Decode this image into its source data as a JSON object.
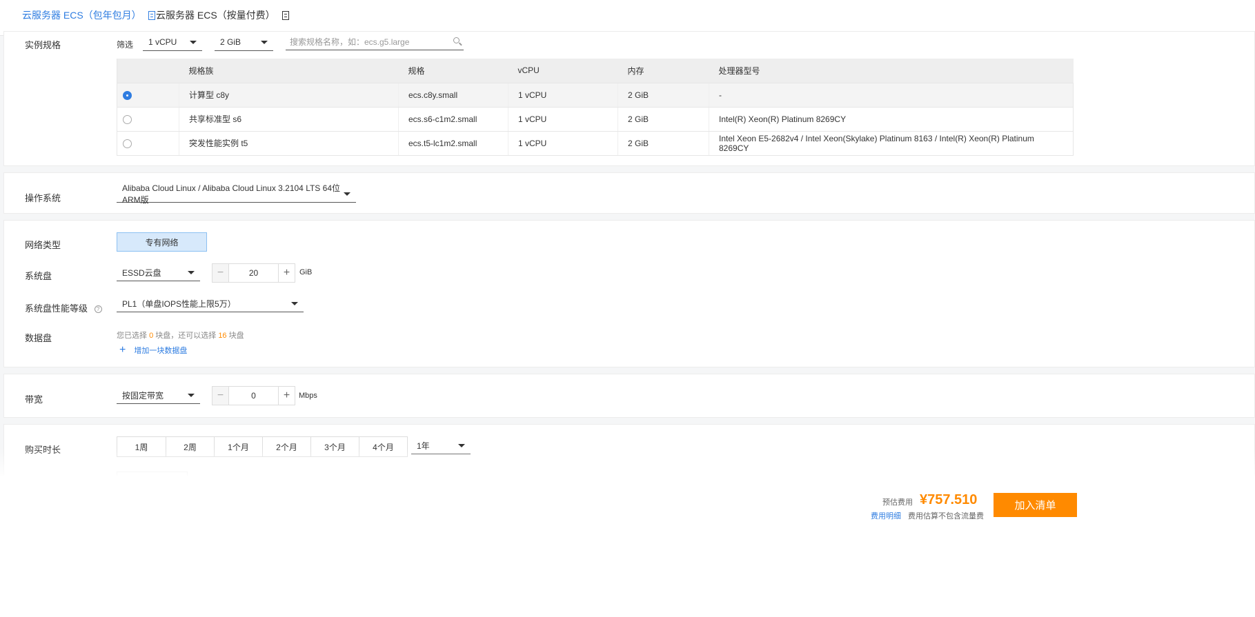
{
  "top_tabs": [
    {
      "label": "云服务器 ECS（包年包月）",
      "icon": "document-icon"
    },
    {
      "label": "云服务器 ECS（按量付费）",
      "icon": "document-icon"
    }
  ],
  "instance": {
    "label": "实例规格",
    "filter_label": "筛选",
    "cpu_select": "1 vCPU",
    "mem_select": "2 GiB",
    "search_placeholder": "搜索规格名称，如：ecs.g5.large",
    "columns": [
      "",
      "规格族",
      "规格",
      "vCPU",
      "内存",
      "处理器型号"
    ],
    "rows": [
      [
        "计算型 c8y",
        "ecs.c8y.small",
        "1 vCPU",
        "2 GiB",
        "-"
      ],
      [
        "共享标准型 s6",
        "ecs.s6-c1m2.small",
        "1 vCPU",
        "2 GiB",
        "Intel(R) Xeon(R) Platinum 8269CY"
      ],
      [
        "突发性能实例 t5",
        "ecs.t5-lc1m2.small",
        "1 vCPU",
        "2 GiB",
        "Intel Xeon E5-2682v4 / Intel Xeon(Skylake) Platinum 8163 / Intel(R) Xeon(R) Platinum 8269CY"
      ]
    ]
  },
  "os": {
    "label": "操作系统",
    "value": "Alibaba Cloud Linux / Alibaba Cloud Linux 3.2104 LTS 64位 ARM版"
  },
  "network": {
    "label": "网络类型",
    "value": "专有网络"
  },
  "system_disk": {
    "label": "系统盘",
    "type": "ESSD云盘",
    "size": "20",
    "unit": "GiB",
    "performance_label": "系统盘性能等级",
    "performance_help": "?",
    "performance_value": "PL1（单盘IOPS性能上限5万）"
  },
  "data_disk": {
    "label": "数据盘",
    "summary_prefix": "您已选择",
    "selected_count": "0",
    "summary_mid": "块盘，还可以选择",
    "remaining_count": "16",
    "summary_suffix": "块盘",
    "add_label": "增加一块数据盘"
  },
  "bandwidth": {
    "label": "带宽",
    "mode": "按固定带宽",
    "value": "0",
    "unit": "Mbps"
  },
  "duration": {
    "label": "购买时长",
    "options": [
      "1周",
      "2周",
      "1个月",
      "2个月",
      "3个月",
      "4个月"
    ],
    "selected": "1年"
  },
  "footer": {
    "estimate_label": "预估费用",
    "price": "¥757.510",
    "detail_link": "费用明细",
    "note": "费用估算不包含流量费",
    "cart_button": "加入清单"
  }
}
